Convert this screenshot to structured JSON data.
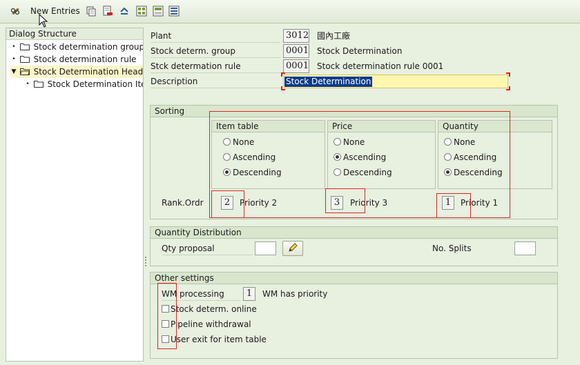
{
  "toolbar": {
    "new_entries_label": "New Entries",
    "icons": [
      "glasses-icon",
      "copy-icon",
      "delete-icon",
      "undo-icon",
      "select-all-icon",
      "select-block-icon",
      "deselect-all-icon"
    ]
  },
  "tree": {
    "header": "Dialog Structure",
    "items": [
      {
        "label": "Stock determination group",
        "state": "leaf"
      },
      {
        "label": "Stock determination rule",
        "state": "leaf"
      },
      {
        "label": "Stock Determination Header",
        "state": "expanded",
        "selected": true
      },
      {
        "label": "Stock Determination Item",
        "state": "leaf"
      }
    ]
  },
  "header": {
    "plant": {
      "label": "Plant",
      "value": "3012",
      "text": "國內工廠"
    },
    "group": {
      "label": "Stock determ. group",
      "value": "0001",
      "text": "Stock Determination"
    },
    "rule": {
      "label": "Stck determation rule",
      "value": "0001",
      "text": "Stock determination rule 0001"
    },
    "description": {
      "label": "Description",
      "value": "Stock Determination"
    }
  },
  "sorting": {
    "title": "Sorting",
    "columns": [
      {
        "title": "Item table",
        "options": [
          "None",
          "Ascending",
          "Descending"
        ],
        "selected": 2,
        "rank": "2",
        "priority_text": "Priority 2"
      },
      {
        "title": "Price",
        "options": [
          "None",
          "Ascending",
          "Descending"
        ],
        "selected": 1,
        "rank": "3",
        "priority_text": "Priority 3"
      },
      {
        "title": "Quantity",
        "options": [
          "None",
          "Ascending",
          "Descending"
        ],
        "selected": 2,
        "rank": "1",
        "priority_text": "Priority 1"
      }
    ],
    "rank_label": "Rank.Ordr"
  },
  "quantity_distribution": {
    "title": "Quantity Distribution",
    "qty_proposal_label": "Qty proposal",
    "qty_proposal_value": "",
    "no_splits_label": "No. Splits",
    "no_splits_value": ""
  },
  "other_settings": {
    "title": "Other settings",
    "wm_label": "WM processing",
    "wm_value": "1",
    "wm_text": "WM has priority",
    "checkboxes": [
      {
        "label": "Stock determ. online",
        "checked": false
      },
      {
        "label": "Pipeline withdrawal",
        "checked": false
      },
      {
        "label": "User exit for item table",
        "checked": false
      }
    ]
  },
  "colors": {
    "highlight_red": "#e02424",
    "selection_blue": "#0a3b8d",
    "accent_yellow": "#fff6b0"
  }
}
